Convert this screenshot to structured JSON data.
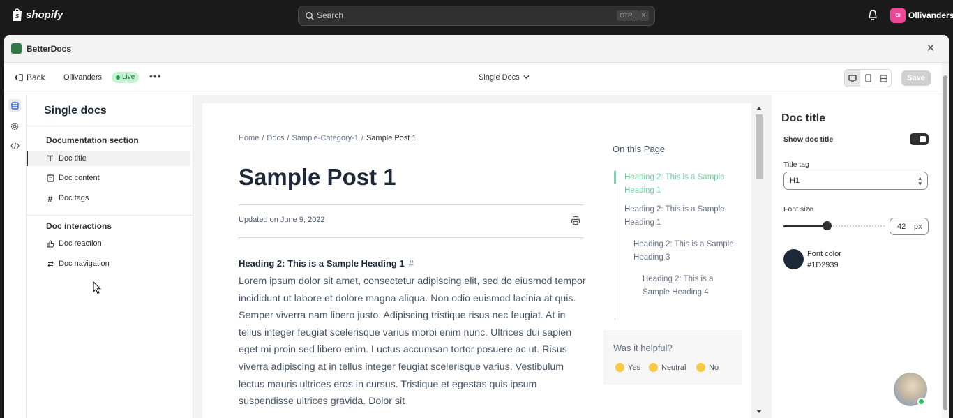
{
  "topbar": {
    "brand": "shopify",
    "search_placeholder": "Search",
    "shortcut_ctrl": "CTRL",
    "shortcut_k": "K",
    "store_initials": "OI",
    "store_name": "Ollivanders"
  },
  "modal": {
    "app_name": "BetterDocs"
  },
  "toolbar": {
    "back_label": "Back",
    "store_label": "Ollivanders",
    "status_badge": "Live",
    "template_selector": "Single Docs",
    "save_label": "Save"
  },
  "left_panel": {
    "title": "Single docs",
    "sections": [
      {
        "heading": "Documentation section",
        "items": [
          {
            "label": "Doc title",
            "icon": "text-icon",
            "selected": true
          },
          {
            "label": "Doc content",
            "icon": "content-icon"
          },
          {
            "label": "Doc tags",
            "icon": "hash-icon"
          }
        ]
      },
      {
        "heading": "Doc interactions",
        "items": [
          {
            "label": "Doc reaction",
            "icon": "thumbs-up-icon"
          },
          {
            "label": "Doc navigation",
            "icon": "swap-icon"
          }
        ]
      }
    ]
  },
  "preview": {
    "breadcrumbs": [
      "Home",
      "/",
      "Docs",
      "/",
      "Sample-Category-1",
      "/",
      "Sample Post 1"
    ],
    "title": "Sample Post 1",
    "updated": "Updated on June 9, 2022",
    "heading": "Heading 2: This is a Sample Heading 1",
    "heading_anchor": "#",
    "paragraph": "Lorem ipsum dolor sit amet, consectetur adipiscing elit, sed do eiusmod tempor incididunt ut labore et dolore magna aliqua. Non odio euismod lacinia at quis. Semper viverra nam libero justo. Adipiscing tristique risus nec feugiat. At in tellus integer feugiat scelerisque varius morbi enim nunc. Ultrices dui sapien eget mi proin sed libero enim. Luctus accumsan tortor posuere ac ut. Risus viverra adipiscing at in tellus integer feugiat scelerisque varius. Vestibulum lectus mauris ultrices eros in cursus. Tristique et egestas quis ipsum suspendisse ultrices gravida. Dolor sit",
    "toc_title": "On this Page",
    "toc": [
      {
        "line1": "Heading 2: This is a Sample",
        "line2": "Heading 1",
        "active": true
      },
      {
        "line1": "Heading 2: This is a Sample",
        "line2": "Heading 1"
      },
      {
        "line1": "Heading 2: This is a Sample",
        "line2": "Heading 3"
      },
      {
        "line1": "Heading 2: This is a",
        "line2": "Sample Heading 4"
      }
    ],
    "helpful": {
      "question": "Was it helpful?",
      "yes": "Yes",
      "neutral": "Neutral",
      "no": "No"
    }
  },
  "right_panel": {
    "title": "Doc title",
    "show_title_label": "Show doc title",
    "show_title_on": true,
    "title_tag_label": "Title tag",
    "title_tag_value": "H1",
    "font_size_label": "Font size",
    "font_size_value": "42",
    "font_size_unit": "px",
    "font_size_slider_fraction": 0.43,
    "font_color_label": "Font color",
    "font_color_value": "#1D2939"
  },
  "colors": {
    "accent": "#303030",
    "live_badge_bg": "#c9f2d5",
    "toc_active": "#6ccf9a",
    "title_color": "#1d2939"
  }
}
